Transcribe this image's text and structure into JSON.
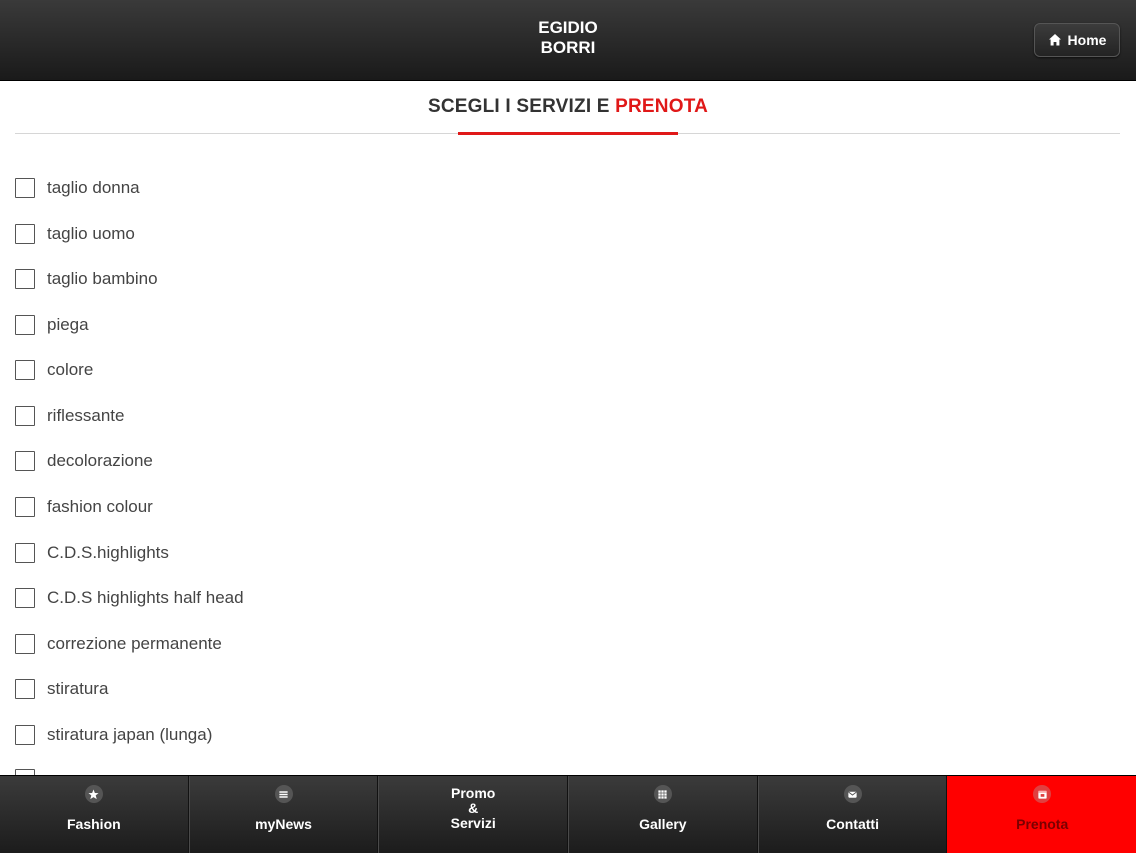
{
  "header": {
    "title_line1": "EGIDIO",
    "title_line2": "BORRI",
    "home_label": "Home"
  },
  "heading": {
    "prefix": "SCEGLI I SERVIZI E ",
    "accent": "PRENOTA"
  },
  "colors": {
    "accent": "#e01818",
    "active_tab": "#ff0000",
    "bar": "#2a2a2a"
  },
  "services": [
    {
      "label": "taglio donna",
      "checked": false
    },
    {
      "label": "taglio uomo",
      "checked": false
    },
    {
      "label": "taglio bambino",
      "checked": false
    },
    {
      "label": "piega",
      "checked": false
    },
    {
      "label": "colore",
      "checked": false
    },
    {
      "label": "riflessante",
      "checked": false
    },
    {
      "label": "decolorazione",
      "checked": false
    },
    {
      "label": "fashion colour",
      "checked": false
    },
    {
      "label": "C.D.S.highlights",
      "checked": false
    },
    {
      "label": "C.D.S highlights half head",
      "checked": false
    },
    {
      "label": "correzione permanente",
      "checked": false
    },
    {
      "label": "stiratura",
      "checked": false
    },
    {
      "label": "stiratura japan (lunga)",
      "checked": false
    },
    {
      "label": "",
      "checked": false
    }
  ],
  "tabs": [
    {
      "label": "Fashion",
      "icon": "star-icon"
    },
    {
      "label": "myNews",
      "icon": "list-icon"
    },
    {
      "label_lines": [
        "Promo",
        "&",
        "Servizi"
      ]
    },
    {
      "label": "Gallery",
      "icon": "grid-icon"
    },
    {
      "label": "Contatti",
      "icon": "mail-icon"
    },
    {
      "label": "Prenota",
      "icon": "calendar-icon",
      "active": true
    }
  ]
}
